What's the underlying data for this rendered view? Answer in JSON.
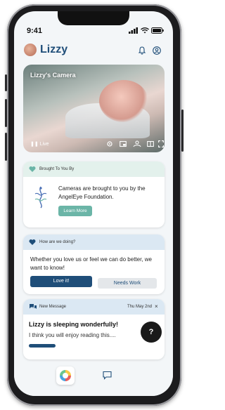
{
  "status": {
    "time": "9:41"
  },
  "app": {
    "title": "Lizzy"
  },
  "camera": {
    "title": "Lizzy's Camera",
    "live_label": "Live"
  },
  "sponsor": {
    "header": "Brought To You By",
    "text": "Cameras are brought to you by the AngelEye Foundation.",
    "button": "Learn More"
  },
  "feedback": {
    "header": "How are we doing?",
    "text": "Whether you love us or feel we can do better, we want to know!",
    "love_button": "Love it!",
    "work_button": "Needs Work"
  },
  "message": {
    "header": "New Message",
    "date": "Thu May 2nd",
    "close": "×",
    "title": "Lizzy is sleeping wonderfully!",
    "body": "I think you will enjoy reading this...."
  },
  "help": {
    "label": "?"
  },
  "colors": {
    "brand": "#1f4e79",
    "accent": "#6bb5a7",
    "sponsor_header": "#e3f1ec",
    "info_header": "#dbe8f3"
  },
  "icons": [
    "bell-icon",
    "profile-icon",
    "settings-icon",
    "pip-icon",
    "share-icon",
    "layout-icon",
    "fullscreen-icon",
    "heart-icon",
    "chat-icon",
    "home-icon"
  ]
}
